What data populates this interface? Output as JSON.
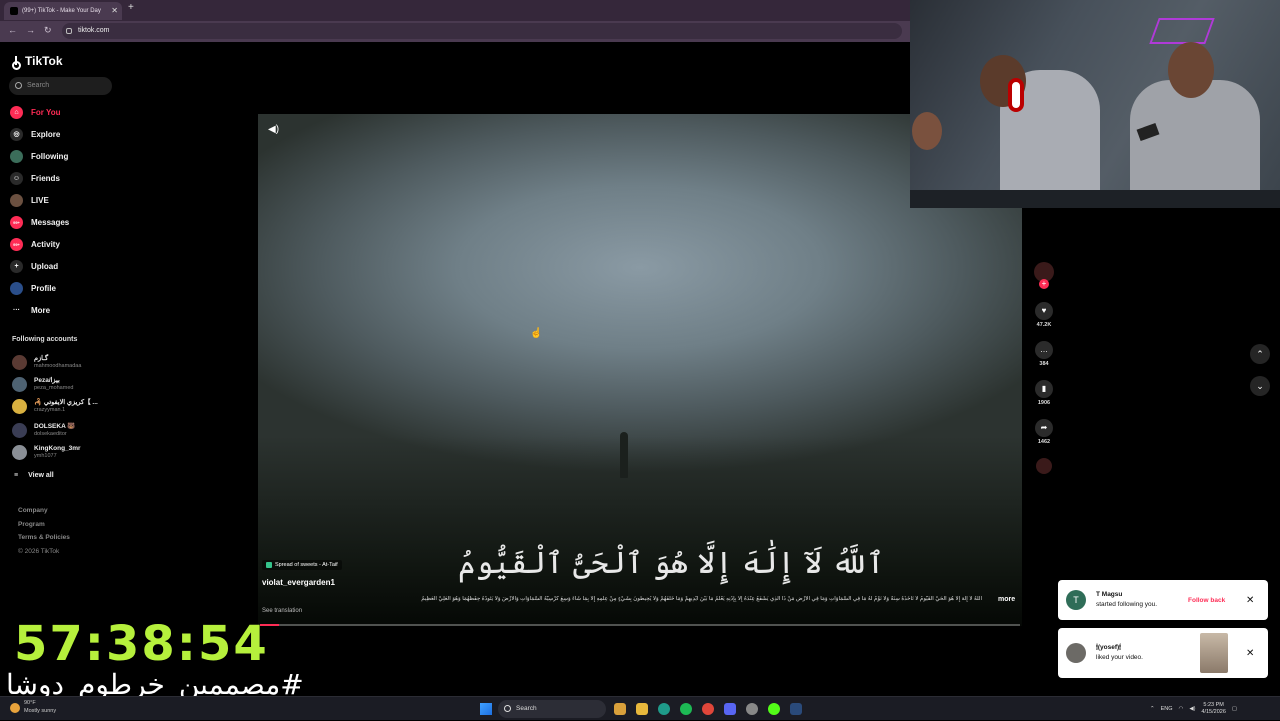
{
  "browser": {
    "tab_title": "(99+) TikTok - Make Your Day",
    "tab_close": "✕",
    "new_tab": "+",
    "url": "tiktok.com"
  },
  "sidebar": {
    "logo": "TikTok",
    "search_placeholder": "Search",
    "menu": [
      {
        "label": "For You",
        "icon": "home-icon"
      },
      {
        "label": "Explore",
        "icon": "compass-icon"
      },
      {
        "label": "Following",
        "icon": "following-icon"
      },
      {
        "label": "Friends",
        "icon": "friends-icon"
      },
      {
        "label": "LIVE",
        "icon": "live-icon"
      },
      {
        "label": "Messages",
        "icon": "messages-icon",
        "badge": "99+"
      },
      {
        "label": "Activity",
        "icon": "activity-icon",
        "badge": "99+"
      },
      {
        "label": "Upload",
        "icon": "upload-icon"
      },
      {
        "label": "Profile",
        "icon": "profile-icon"
      },
      {
        "label": "More",
        "icon": "more-icon"
      }
    ],
    "following_title": "Following accounts",
    "accounts": [
      {
        "name": "گـازم",
        "handle": "mahmoodhamadaa"
      },
      {
        "name": "Peza/بيزا",
        "handle": "peza_mohamed"
      },
      {
        "name": "🦂 كريزي الايفوتي【 ...",
        "handle": "crazyyman.1"
      },
      {
        "name": "DOLSEKA 🐻",
        "handle": "dolsekaeditor"
      },
      {
        "name": "KingKong_3mr",
        "handle": "ymh1077"
      }
    ],
    "view_all": "View all",
    "footer": [
      "Company",
      "Program",
      "Terms & Policies",
      "© 2026 TikTok"
    ]
  },
  "video": {
    "arabic_overlay": "ٱللَّهُ لَآ إِلَٰهَ إِلَّا هُوَ ٱلْحَىُّ ٱلْقَيُّومُ",
    "music": "Spread of sweets - At-Taif",
    "author": "violat_evergarden1",
    "caption": "اللَّهُ لا إِلَهَ إِلا هُوَ الْحَيُّ الْقَيُّومُ لا تَأْخُذُهُ سِنَةٌ وَلا نَوْمٌ لَهُ مَا فِي السَّمَاوَاتِ وَمَا فِي الأَرْضِ مَنْ ذَا الَّذِي يَشْفَعُ عِنْدَهُ إِلا بِإِذْنِهِ يَعْلَمُ مَا بَيْنَ أَيْدِيهِمْ وَمَا خَلْفَهُمْ وَلا يُحِيطُونَ بِشَيْءٍ مِنْ عِلْمِهِ إِلا بِمَا شَاءَ وَسِعَ كُرْسِيُّهُ السَّمَاوَاتِ وَالأَرْضَ وَلا يَئُودُهُ حِفْظُهُمَا وَهُوَ الْعَلِيُّ الْعَظِيمُ",
    "more": "more",
    "see_translation": "See translation",
    "progress": 0.025
  },
  "actions": {
    "likes": "47.2K",
    "comments": "384",
    "saves": "1906",
    "shares": "1462"
  },
  "overlay": {
    "timer": "57:38:54",
    "hashtag": "#مصممين_خرطوم_دوشا"
  },
  "notifications": [
    {
      "initial": "T",
      "name": "T Magsu",
      "text": "started following you.",
      "action": "Follow back"
    },
    {
      "name": "🕯(yosef)🕯",
      "text": "liked your video."
    }
  ],
  "taskbar": {
    "weather_temp": "90°F",
    "weather_desc": "Mostly sunny",
    "search": "Search",
    "lang": "ENG",
    "time": "5:23 PM",
    "date": "4/15/2026"
  },
  "colors": {
    "accent": "#fe2c55",
    "timer": "#b6f03c"
  }
}
